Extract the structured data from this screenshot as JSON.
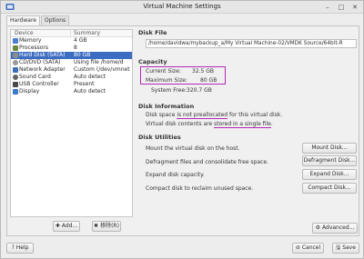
{
  "window": {
    "title": "Virtual Machine Settings"
  },
  "tabs": [
    {
      "label": "Hardware"
    },
    {
      "label": "Options"
    }
  ],
  "devices": {
    "header": {
      "device": "Device",
      "summary": "Summary"
    },
    "rows": [
      {
        "name": "Memory",
        "summary": "4 GB",
        "icon": "memory-icon",
        "color": "#4a7fcf"
      },
      {
        "name": "Processors",
        "summary": "8",
        "icon": "processor-icon",
        "color": "#6a8a3a"
      },
      {
        "name": "Hard Disk (SATA)",
        "summary": "80 GB",
        "icon": "hard-disk-icon",
        "color": "#8c8c8c"
      },
      {
        "name": "CD/DVD (SATA)",
        "summary": "Using file /home/d",
        "icon": "cd-dvd-icon",
        "color": "#9a9a9a"
      },
      {
        "name": "Network Adapter",
        "summary": "Custom (/dev/vmnet",
        "icon": "network-icon",
        "color": "#3d6fb8"
      },
      {
        "name": "Sound Card",
        "summary": "Auto detect",
        "icon": "sound-icon",
        "color": "#666666"
      },
      {
        "name": "USB Controller",
        "summary": "Present",
        "icon": "usb-icon",
        "color": "#4a4a4a"
      },
      {
        "name": "Display",
        "summary": "Auto detect",
        "icon": "display-icon",
        "color": "#3b79c9"
      }
    ],
    "selected_index": 2,
    "add_label": "Add...",
    "remove_label": "移除(R)"
  },
  "disk_file": {
    "title": "Disk File",
    "path": "/home/davidwa/mybackup_a/My Virtual Machine-02/VMDK Source/64bit-R"
  },
  "capacity": {
    "title": "Capacity",
    "current_label": "Current Size:",
    "current_value": "32.5 GB",
    "maximum_label": "Maximum Size:",
    "maximum_value": "80 GB",
    "free_label": "System Free:",
    "free_value": "320.7 GB"
  },
  "disk_info": {
    "title": "Disk Information",
    "line1_pre": "Disk space",
    "line1_mark": "is not preallocated",
    "line1_post": "for this virtual disk.",
    "line2_pre": "Virtual disk contents are",
    "line2_mark": "stored in a single file",
    "line2_post": "."
  },
  "utilities": {
    "title": "Disk Utilities",
    "items": [
      {
        "desc": "Mount the virtual disk on the host.",
        "button": "Mount Disk..."
      },
      {
        "desc": "Defragment files and consolidate free space.",
        "button": "Defragment Disk..."
      },
      {
        "desc": "Expand disk capacity.",
        "button": "Expand Disk..."
      },
      {
        "desc": "Compact disk to reclaim unused space.",
        "button": "Compact Disk..."
      }
    ]
  },
  "advanced_label": "Advanced...",
  "footer": {
    "help": "Help",
    "cancel": "Cancel",
    "save": "Save"
  },
  "colors": {
    "selection": "#3c6dc2",
    "highlight": "#b22bb5"
  }
}
